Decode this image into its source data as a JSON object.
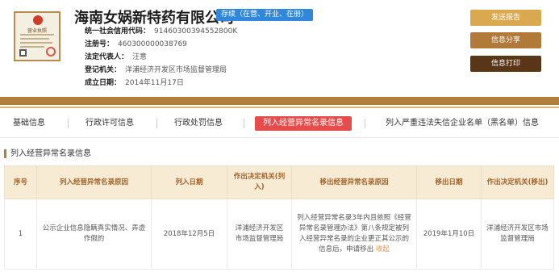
{
  "company": {
    "name": "海南女娲新特药有限公司",
    "status": "存续（在营、开业、在册）",
    "license_image_title": "营业执照"
  },
  "info": [
    {
      "label": "统一社会信用代码：",
      "value": "91460300394552800K"
    },
    {
      "label": "注册号：",
      "value": "460300000038769"
    },
    {
      "label": "法定代表人：",
      "value": "汪意"
    },
    {
      "label": "登记机关：",
      "value": "洋浦经济开发区市场监督管理局"
    },
    {
      "label": "成立日期：",
      "value": "2014年11月17日"
    }
  ],
  "actions": {
    "report": "发送报告",
    "share": "信息分享",
    "print": "信息打印"
  },
  "tabs": [
    {
      "label": "基础信息",
      "active": false
    },
    {
      "label": "行政许可信息",
      "active": false
    },
    {
      "label": "行政处罚信息",
      "active": false
    },
    {
      "label": "列入经营异常名录信息",
      "active": true
    },
    {
      "label": "列入严重违法失信企业名单（黑名单）信息",
      "active": false
    }
  ],
  "section": {
    "title": "列入经营异常名录信息"
  },
  "table": {
    "headers": [
      "序号",
      "列入经营异常名录原因",
      "列入日期",
      "作出决定机关(列入)",
      "移出经营异常名录原因",
      "移出日期",
      "作出决定机关(移出)"
    ],
    "rows": [
      {
        "index": "1",
        "reason_in": "公示企业信息隐瞒真实情况、弄虚作假的",
        "date_in": "2018年12月5日",
        "authority_in": "洋浦经济开发区市场监督管理局",
        "reason_out": "列入经营异常名录3年内且依照《经营异常名录管理办法》第八条规定被列入经营异常名录的企业更正其公示的信息后，申请移出",
        "reason_out_more": "收起",
        "date_out": "2019年1月10日",
        "authority_out": "洋浦经济开发区市场监督管理局"
      }
    ]
  },
  "colors": {
    "brand_brown": "#b07f3c",
    "status_blue": "#2f88d9",
    "active_tab_red": "#e74c4c",
    "table_header_bg": "#f8ebd3",
    "table_header_text": "#a0622a",
    "btn_report": "#d9a84f",
    "btn_share": "#b27a38",
    "btn_print": "#5a3619"
  }
}
